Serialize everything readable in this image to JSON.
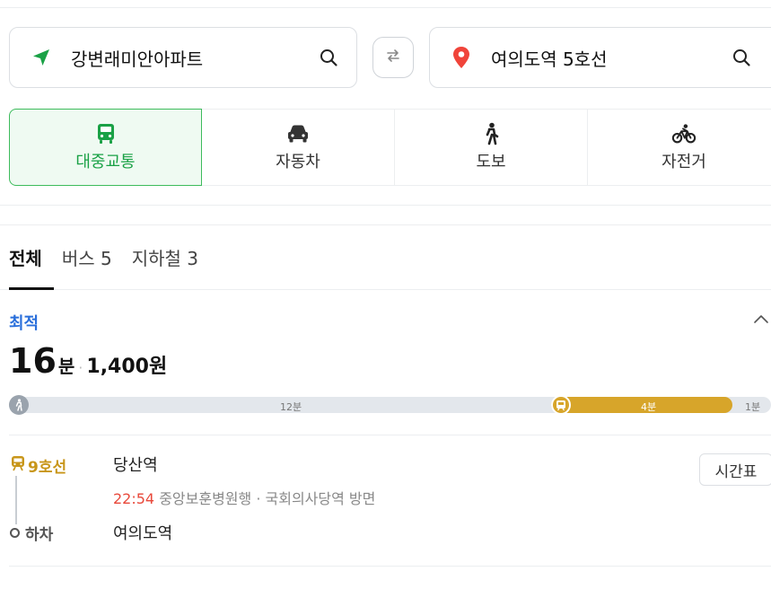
{
  "search": {
    "origin": "강변래미안아파트",
    "destination": "여의도역 5호선"
  },
  "modes": [
    {
      "label": "대중교통",
      "icon": "bus-icon",
      "active": true
    },
    {
      "label": "자동차",
      "icon": "car-icon",
      "active": false
    },
    {
      "label": "도보",
      "icon": "walk-icon",
      "active": false
    },
    {
      "label": "자전거",
      "icon": "bicycle-icon",
      "active": false
    }
  ],
  "filters": [
    {
      "label": "전체",
      "active": true
    },
    {
      "label": "버스 5",
      "active": false
    },
    {
      "label": "지하철 3",
      "active": false
    }
  ],
  "route": {
    "badge": "최적",
    "minutes": "16",
    "minutes_unit": "분",
    "separator": "·",
    "fare": "1,400원",
    "timeline": {
      "walk_label": "12분",
      "subway_label": "4분",
      "end_label": "1분"
    },
    "steps": {
      "board_line": "9호선",
      "board_station": "당산역",
      "depart_time": "22:54",
      "depart_info": "중앙보훈병원행 · 국회의사당역 방면",
      "timetable": "시간표",
      "alight_label": "하차",
      "alight_station": "여의도역"
    }
  },
  "colors": {
    "accent_green": "#1aa146",
    "subway_line9": "#d7a52a",
    "best_blue": "#2a6fdb",
    "time_red": "#e8483a"
  }
}
